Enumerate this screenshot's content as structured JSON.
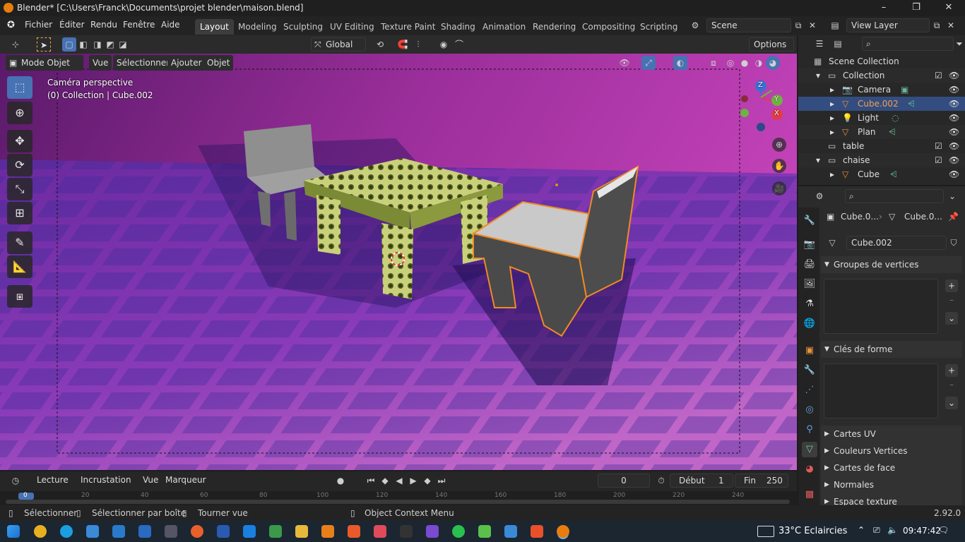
{
  "window": {
    "title": "Blender* [C:\\Users\\Franck\\Documents\\projet blender\\maison.blend]"
  },
  "menus": [
    "Fichier",
    "Éditer",
    "Rendu",
    "Fenêtre",
    "Aide"
  ],
  "workspaces": [
    "Layout",
    "Modeling",
    "Sculpting",
    "UV Editing",
    "Texture Paint",
    "Shading",
    "Animation",
    "Rendering",
    "Compositing",
    "Scripting"
  ],
  "scene": {
    "name": "Scene",
    "view_layer": "View Layer"
  },
  "vp_toolbar": {
    "orientation": "Global",
    "options": "Options"
  },
  "vp_header": {
    "mode": "Mode Objet",
    "menus": [
      "Vue",
      "Sélectionner",
      "Ajouter",
      "Objet"
    ]
  },
  "viewport": {
    "camera_label": "Caméra perspective",
    "collection_label": "(0) Collection | Cube.002"
  },
  "gizmo": {
    "z": "Z",
    "y": "Y",
    "x": "X"
  },
  "outliner": {
    "rows": [
      {
        "label": "Scene Collection"
      },
      {
        "label": "Collection"
      },
      {
        "label": "Camera"
      },
      {
        "label": "Cube.002"
      },
      {
        "label": "Light"
      },
      {
        "label": "Plan"
      },
      {
        "label": "table"
      },
      {
        "label": "chaise"
      },
      {
        "label": "Cube"
      }
    ]
  },
  "props": {
    "breadcrumb": [
      "Cube.0...",
      "Cube.0..."
    ],
    "mesh_name": "Cube.002",
    "panels": [
      "Groupes de vertices",
      "Clés de forme",
      "Cartes UV",
      "Couleurs Vertices",
      "Cartes de face",
      "Normales",
      "Espace texture"
    ]
  },
  "timeline": {
    "menus": [
      "Lecture",
      "Incrustation",
      "Vue",
      "Marqueur"
    ],
    "current_frame": "0",
    "start_label": "Début",
    "start": "1",
    "end_label": "Fin",
    "end": "250",
    "ruler": [
      "0",
      "20",
      "40",
      "60",
      "80",
      "100",
      "120",
      "140",
      "160",
      "180",
      "200",
      "220",
      "240"
    ]
  },
  "status": {
    "select": "Sélectionner",
    "box_select": "Sélectionner par boîte",
    "rotate": "Tourner vue",
    "context": "Object Context Menu",
    "version": "2.92.0"
  },
  "taskbar": {
    "weather": "33°C Eclaircies",
    "time": "09:47:42"
  },
  "colors": {
    "accent": "#4772b3",
    "selected_row": "#334d80",
    "highlight_orange": "#f08a24",
    "viewport_magenta": "#b03aa8"
  }
}
